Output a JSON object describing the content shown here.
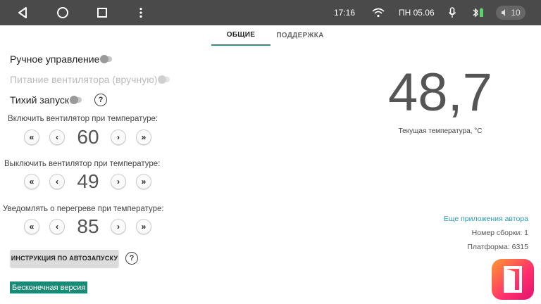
{
  "status_bar": {
    "time": "17:16",
    "date": "ПН 05.06",
    "volume": "10",
    "icons": [
      "back-icon",
      "home-icon",
      "recents-icon",
      "more-icon",
      "wifi-icon",
      "mic-icon",
      "bluetooth-battery-icon",
      "volume-icon"
    ]
  },
  "tabs": [
    {
      "label": "ОБЩИЕ",
      "active": true
    },
    {
      "label": "ПОДДЕРЖКА",
      "active": false
    }
  ],
  "toggles": {
    "manual": {
      "label": "Ручное управление",
      "on": false
    },
    "fan_power": {
      "label": "Питание вентилятора (вручную)",
      "on": false,
      "enabled": false
    },
    "quiet": {
      "label": "Тихий запуск",
      "on": false
    }
  },
  "help_symbol": "?",
  "steppers": [
    {
      "label": "Включить вентилятор при температуре:",
      "value": "60"
    },
    {
      "label": "Выключить вентилятор при температуре:",
      "value": "49"
    },
    {
      "label": "Уведомлять о перегреве при температуре:",
      "value": "85"
    }
  ],
  "stepper_glyphs": {
    "fast_down": "«",
    "down": "‹",
    "up": "›",
    "fast_up": "»"
  },
  "instruction_button": "ИНСТРУКЦИЯ ПО АВТОЗАПУСКУ",
  "version_badge": "Бесконечная версия",
  "temperature": {
    "value": "48,7",
    "caption": "Текущая температура, °C"
  },
  "info": {
    "more_apps": "Еще приложения автора",
    "build": "Номер сборки: 1",
    "platform": "Платформа: 6315"
  },
  "colors": {
    "accent": "#1a8a76",
    "link": "#2a9db4",
    "status_bar": "#4a4a4a"
  }
}
